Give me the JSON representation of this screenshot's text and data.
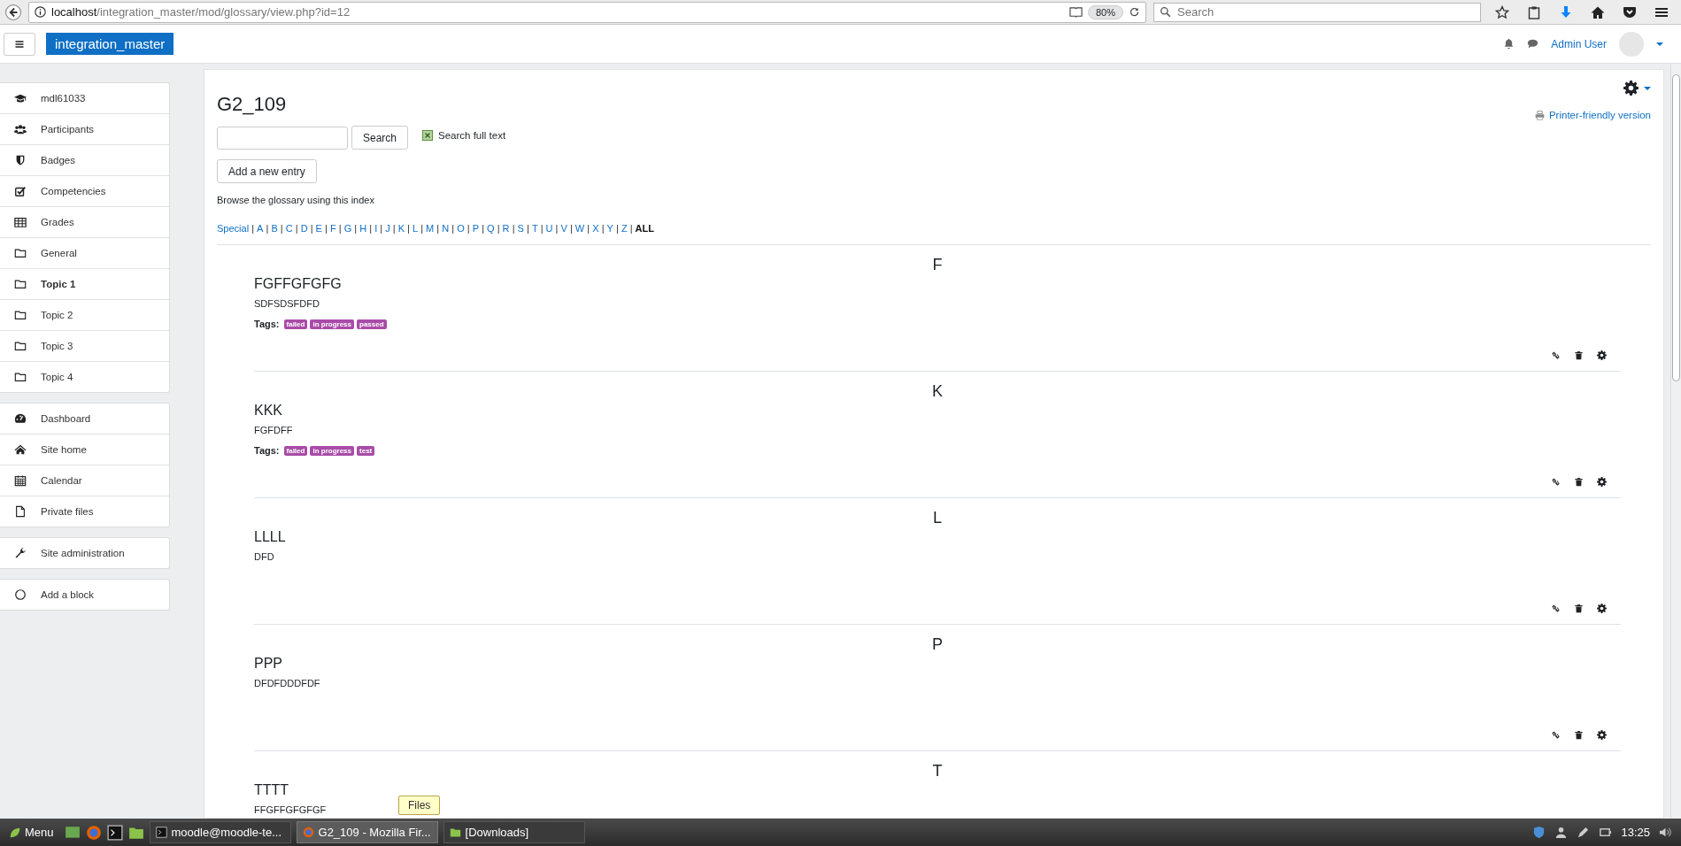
{
  "browser": {
    "url_host": "localhost",
    "url_path": "/integration_master/mod/glossary/view.php?id=12",
    "zoom": "80%",
    "search_placeholder": "Search"
  },
  "navbar": {
    "brand": "integration_master",
    "user": "Admin User"
  },
  "sidebar": [
    [
      {
        "label": "mdl61033",
        "kind": "course",
        "active": false
      },
      {
        "label": "Participants",
        "kind": "participants",
        "active": false
      },
      {
        "label": "Badges",
        "kind": "badges",
        "active": false
      },
      {
        "label": "Competencies",
        "kind": "competencies",
        "active": false
      },
      {
        "label": "Grades",
        "kind": "grades",
        "active": false
      },
      {
        "label": "General",
        "kind": "section",
        "active": false
      },
      {
        "label": "Topic 1",
        "kind": "section",
        "active": true
      },
      {
        "label": "Topic 2",
        "kind": "section",
        "active": false
      },
      {
        "label": "Topic 3",
        "kind": "section",
        "active": false
      },
      {
        "label": "Topic 4",
        "kind": "section",
        "active": false
      }
    ],
    [
      {
        "label": "Dashboard",
        "kind": "dashboard",
        "active": false
      },
      {
        "label": "Site home",
        "kind": "home",
        "active": false
      },
      {
        "label": "Calendar",
        "kind": "calendar",
        "active": false
      },
      {
        "label": "Private files",
        "kind": "files",
        "active": false
      }
    ],
    [
      {
        "label": "Site administration",
        "kind": "admin",
        "active": false
      }
    ],
    [
      {
        "label": "Add a block",
        "kind": "block",
        "active": false
      }
    ]
  ],
  "page": {
    "title": "G2_109",
    "printer_link": "Printer-friendly version",
    "search_button": "Search",
    "full_text": {
      "label": "Search full text",
      "checked": true
    },
    "add_button": "Add a new entry",
    "browse_text": "Browse the glossary using this index",
    "index": [
      {
        "label": "Special",
        "selected": false
      },
      {
        "sep": "|",
        "label": "A",
        "selected": false
      },
      {
        "sep": "|",
        "label": "B",
        "selected": false
      },
      {
        "sep": "|",
        "label": "C",
        "selected": false
      },
      {
        "sep": "|",
        "label": "D",
        "selected": false
      },
      {
        "sep": "|",
        "label": "E",
        "selected": false
      },
      {
        "sep": "|",
        "label": "F",
        "selected": false
      },
      {
        "sep": "|",
        "label": "G",
        "selected": false
      },
      {
        "sep": "|",
        "label": "H",
        "selected": false
      },
      {
        "sep": "|",
        "label": "I",
        "selected": false
      },
      {
        "sep": "|",
        "label": "J",
        "selected": false
      },
      {
        "sep": "|",
        "label": "K",
        "selected": false
      },
      {
        "sep": "|",
        "label": "L",
        "selected": false
      },
      {
        "sep": "|",
        "label": "M",
        "selected": false
      },
      {
        "sep": "|",
        "label": "N",
        "selected": false
      },
      {
        "sep": "|",
        "label": "O",
        "selected": false
      },
      {
        "sep": "|",
        "label": "P",
        "selected": false
      },
      {
        "sep": "|",
        "label": "Q",
        "selected": false
      },
      {
        "sep": "|",
        "label": "R",
        "selected": false
      },
      {
        "sep": "|",
        "label": "S",
        "selected": false
      },
      {
        "sep": "|",
        "label": "T",
        "selected": false
      },
      {
        "sep": "|",
        "label": "U",
        "selected": false
      },
      {
        "sep": "|",
        "label": "V",
        "selected": false
      },
      {
        "sep": "|",
        "label": "W",
        "selected": false
      },
      {
        "sep": "|",
        "label": "X",
        "selected": false
      },
      {
        "sep": "|",
        "label": "Y",
        "selected": false
      },
      {
        "sep": "|",
        "label": "Z",
        "selected": false
      },
      {
        "sep": "|",
        "label": "ALL",
        "selected": true
      }
    ],
    "entries": [
      {
        "letter": "F",
        "concept": "FGFFGFGFG",
        "definition": "SDFSDSFDFD",
        "tags_label": "Tags:",
        "tags": [
          "failed",
          "in progress",
          "passed"
        ]
      },
      {
        "letter": "K",
        "concept": "KKK",
        "definition": "FGFDFF",
        "tags_label": "Tags:",
        "tags": [
          "failed",
          "in progress",
          "test"
        ]
      },
      {
        "letter": "L",
        "concept": "LLLL",
        "definition": "DFD"
      },
      {
        "letter": "P",
        "concept": "PPP",
        "definition": "DFDFDDDFDF"
      },
      {
        "letter": "T",
        "concept": "TTTT",
        "definition": "FFGFFGFGFGF"
      }
    ]
  },
  "taskbar": {
    "menu": "Menu",
    "tasks": [
      {
        "label": "moodle@moodle-te...",
        "kind": "terminal",
        "selected": false
      },
      {
        "label": "G2_109 - Mozilla Fir...",
        "kind": "browser",
        "selected": true
      },
      {
        "label": "[Downloads]",
        "kind": "folder",
        "selected": false
      }
    ],
    "tooltip": "Files",
    "time": "13:25"
  }
}
